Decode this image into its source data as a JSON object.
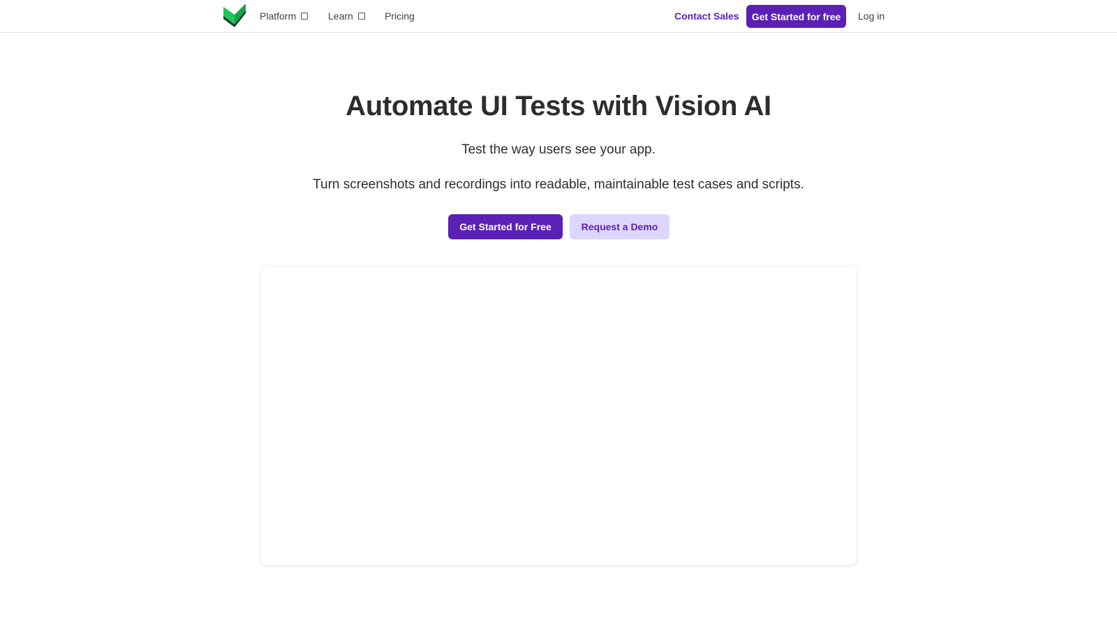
{
  "nav": {
    "items": [
      {
        "label": "Platform",
        "has_dropdown": true
      },
      {
        "label": "Learn",
        "has_dropdown": true
      },
      {
        "label": "Pricing",
        "has_dropdown": false
      }
    ],
    "contact_sales": "Contact Sales",
    "get_started": "Get Started for free",
    "login": "Log in",
    "logo_icon": "checkmark-shield-logo"
  },
  "hero": {
    "title": "Automate UI Tests with Vision AI",
    "subtitle": "Test the way users see your app.",
    "description": "Turn screenshots and recordings into readable, maintainable test cases and scripts.",
    "primary_cta": "Get Started for Free",
    "secondary_cta": "Request a Demo"
  },
  "colors": {
    "accent": "#5b21b6",
    "accent_light": "#ddd6fe",
    "logo_green": "#22c55e",
    "logo_dark": "#14532d"
  }
}
